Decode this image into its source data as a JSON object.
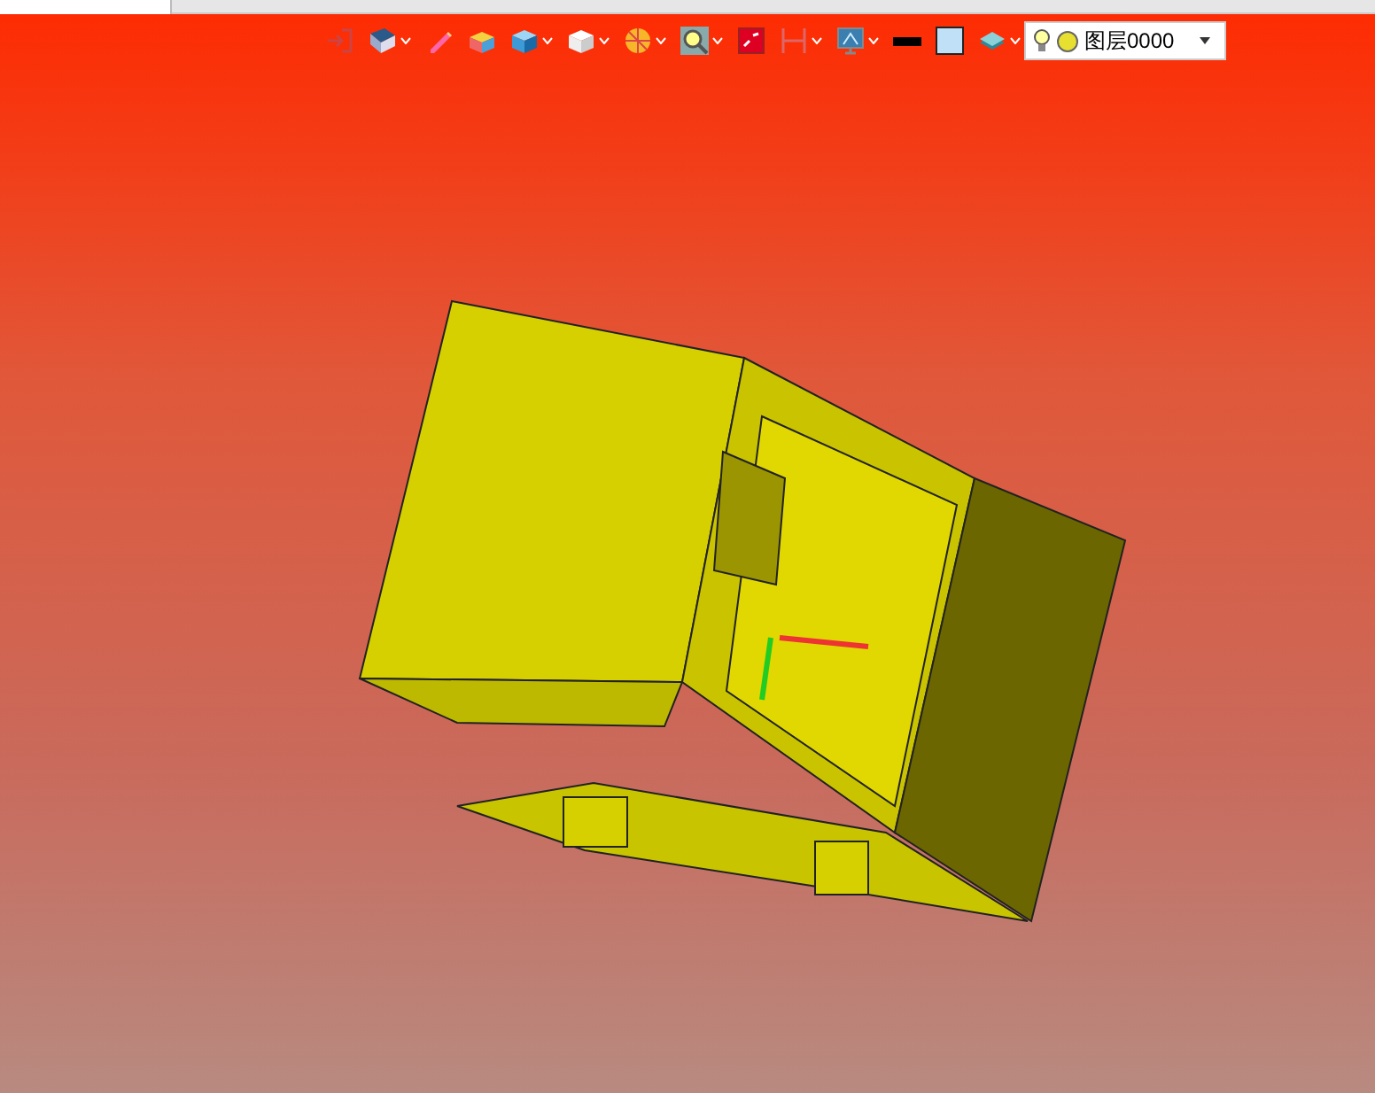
{
  "toolbar": {
    "tools": [
      {
        "kind": "exit",
        "menu": false
      },
      {
        "kind": "view",
        "menu": true
      },
      {
        "kind": "pencil",
        "menu": false
      },
      {
        "kind": "colorbox",
        "menu": false
      },
      {
        "kind": "bluecube",
        "menu": true
      },
      {
        "kind": "whitecube",
        "menu": true
      },
      {
        "kind": "pie",
        "menu": true
      },
      {
        "kind": "zoom",
        "menu": true
      },
      {
        "kind": "frame",
        "menu": false
      },
      {
        "kind": "measure",
        "menu": true
      },
      {
        "kind": "monitor",
        "menu": true
      },
      {
        "kind": "linecolor",
        "menu": false
      },
      {
        "kind": "fillcolor",
        "menu": false
      },
      {
        "kind": "layers",
        "menu": true
      }
    ]
  },
  "layer_select": {
    "value": "图层0000",
    "on": true
  }
}
